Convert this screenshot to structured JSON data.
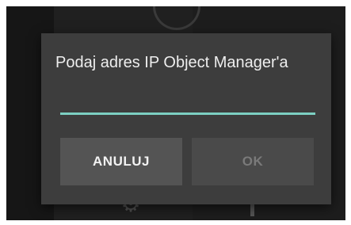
{
  "dialog": {
    "title": "Podaj adres IP Object Manager'a",
    "input": {
      "value": "",
      "placeholder": ""
    },
    "buttons": {
      "cancel_label": "ANULUJ",
      "ok_label": "OK",
      "ok_enabled": false
    }
  },
  "colors": {
    "dialog_background": "#3d3d3d",
    "input_underline_accent": "#7ccfc2",
    "cancel_button": "#545454",
    "ok_button_disabled": "#4a4a4a"
  },
  "icons": {
    "background_gear": "gear-icon"
  }
}
